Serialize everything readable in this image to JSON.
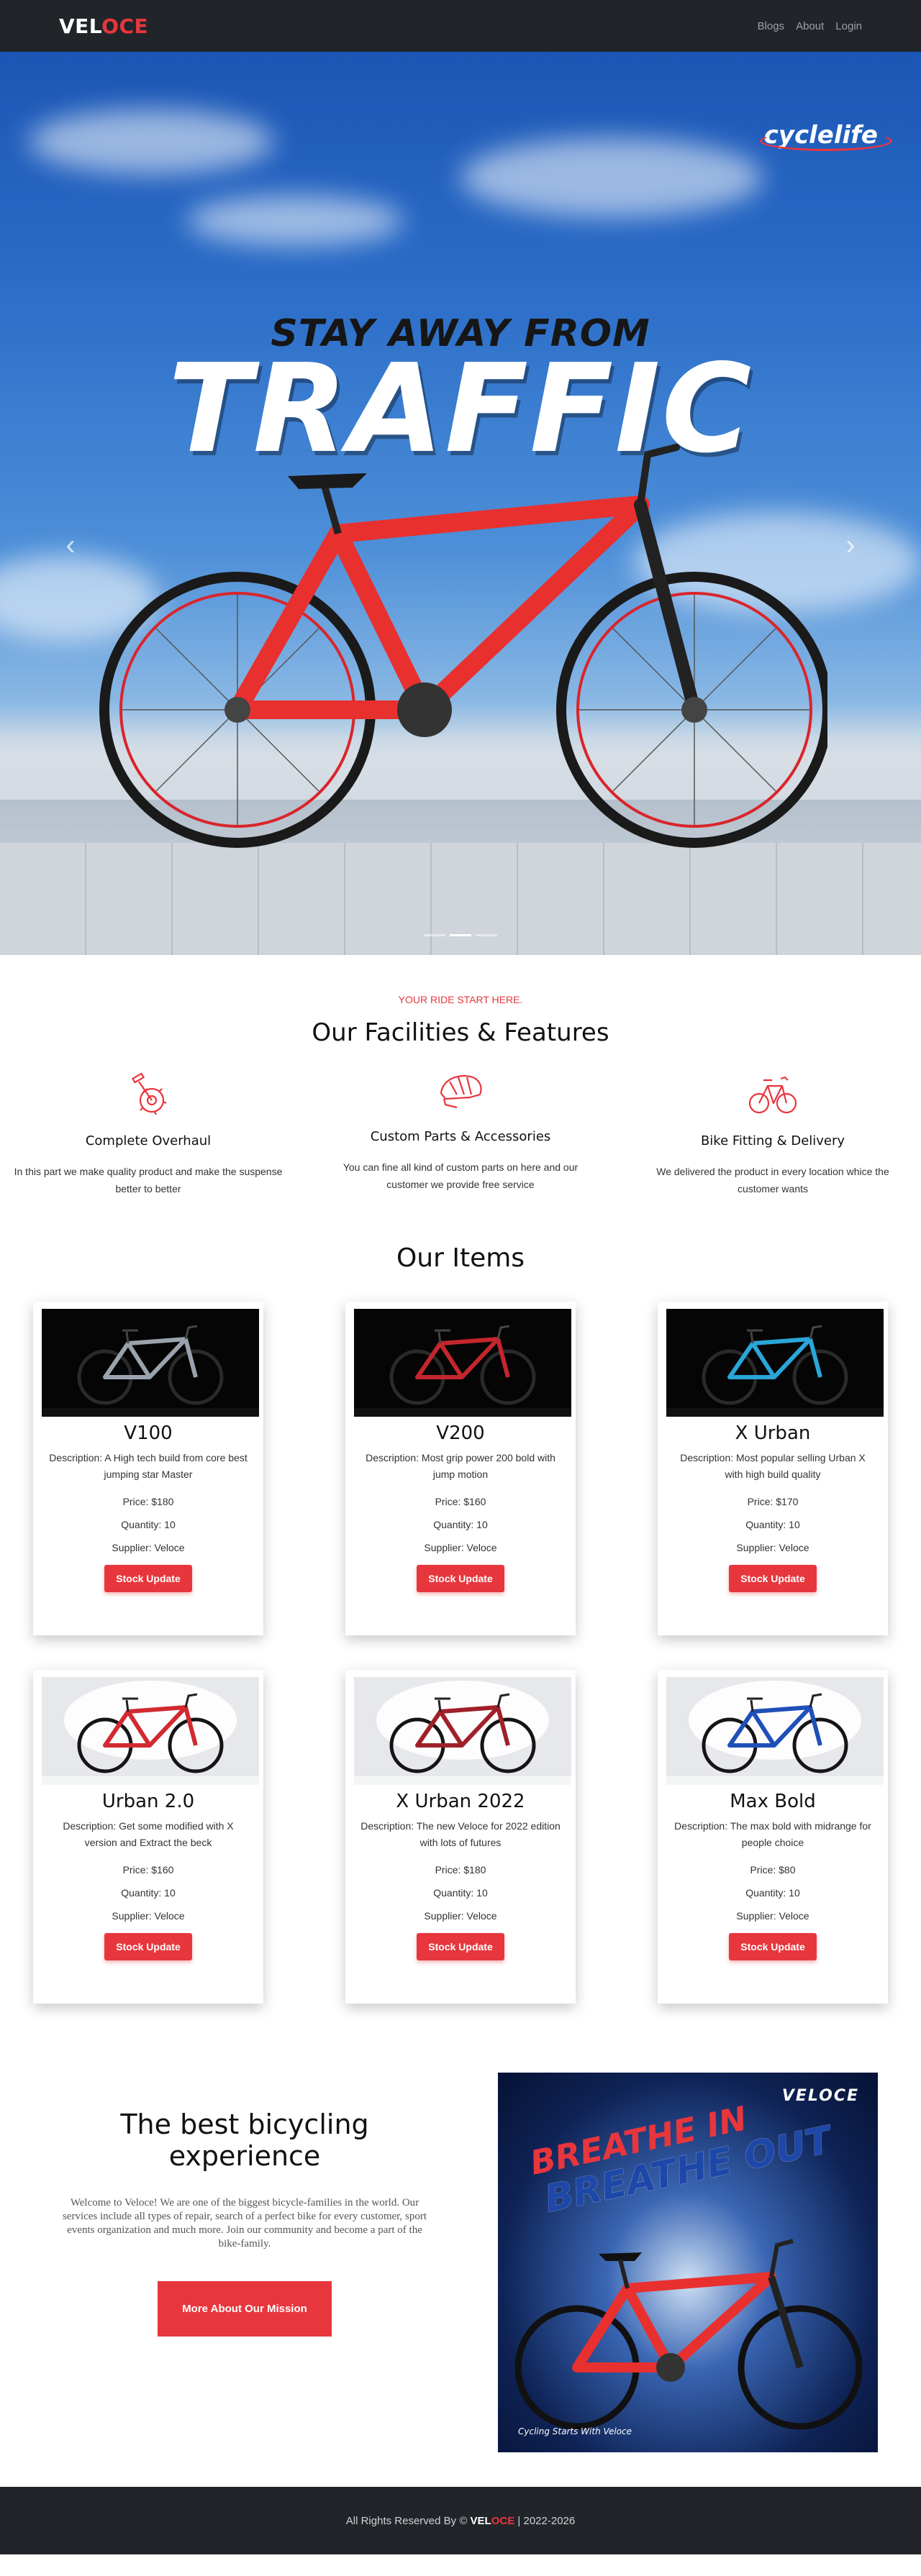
{
  "nav": {
    "brand_white": "VEL",
    "brand_red": "OCE",
    "links": [
      "Blogs",
      "About",
      "Login"
    ]
  },
  "hero": {
    "partner_logo": "cyclelife",
    "headline_top": "STAY AWAY FROM",
    "headline_main": "TRAFFIC",
    "prev_icon": "chevron-left-icon",
    "next_icon": "chevron-right-icon",
    "slide_count": 3,
    "active_slide": 2
  },
  "facilities": {
    "kicker": "YOUR RIDE START HERE.",
    "title": "Our Facilities & Features",
    "features": [
      {
        "icon": "crankset-icon",
        "title": "Complete Overhaul",
        "text": "In this part we make quality product and make the suspense better to better"
      },
      {
        "icon": "helmet-icon",
        "title": "Custom Parts & Accessories",
        "text": "You can fine all kind of custom parts on here and our customer we provide free service"
      },
      {
        "icon": "bike-icon",
        "title": "Bike Fitting & Delivery",
        "text": "We delivered the product in every location whice the customer wants"
      }
    ]
  },
  "items": {
    "title": "Our Items",
    "button_label": "Stock Update",
    "list": [
      {
        "name": "V100",
        "description": "Description: A High tech build from core best jumping star Master",
        "price": "Price: $180",
        "quantity": "Quantity: 10",
        "supplier": "Supplier: Veloce",
        "theme": "dark",
        "accent": "#9aa3ad"
      },
      {
        "name": "V200",
        "description": "Description: Most grip power 200 bold with jump motion",
        "price": "Price: $160",
        "quantity": "Quantity: 10",
        "supplier": "Supplier: Veloce",
        "theme": "dark",
        "accent": "#c4262d"
      },
      {
        "name": "X Urban",
        "description": "Description: Most popular selling Urban X with high build quality",
        "price": "Price: $170",
        "quantity": "Quantity: 10",
        "supplier": "Supplier: Veloce",
        "theme": "dark",
        "accent": "#2aa6d8"
      },
      {
        "name": "Urban 2.0",
        "description": "Description: Get some modified with X version and Extract the beck",
        "price": "Price: $160",
        "quantity": "Quantity: 10",
        "supplier": "Supplier: Veloce",
        "theme": "light",
        "accent": "#d12a30"
      },
      {
        "name": "X Urban 2022",
        "description": "Description: The new Veloce for 2022 edition with lots of futures",
        "price": "Price: $180",
        "quantity": "Quantity: 10",
        "supplier": "Supplier: Veloce",
        "theme": "light",
        "accent": "#a0202a"
      },
      {
        "name": "Max Bold",
        "description": "Description: The max bold with midrange for people choice",
        "price": "Price: $80",
        "quantity": "Quantity: 10",
        "supplier": "Supplier: Veloce",
        "theme": "light",
        "accent": "#1f4fb8"
      }
    ]
  },
  "about": {
    "title": "The best bicycling experience",
    "text": "Welcome to Veloce! We are one of the biggest bicycle-families in the world. Our services include all types of repair, search of a perfect bike for every customer, sport events organization and much more. Join our community and become a part of the bike-family.",
    "button_label": "More About Our Mission",
    "poster": {
      "brand": "VELOCE",
      "line1": "BREATHE IN",
      "line2": "BREATHE OUT",
      "footer": "Cycling Starts With Veloce"
    }
  },
  "footer": {
    "prefix": "All Rights Reserved By © ",
    "brand_white": "VEL",
    "brand_red": "OCE",
    "suffix": " | 2022-2026"
  },
  "colors": {
    "accent": "#e8363d",
    "dark": "#212529"
  }
}
